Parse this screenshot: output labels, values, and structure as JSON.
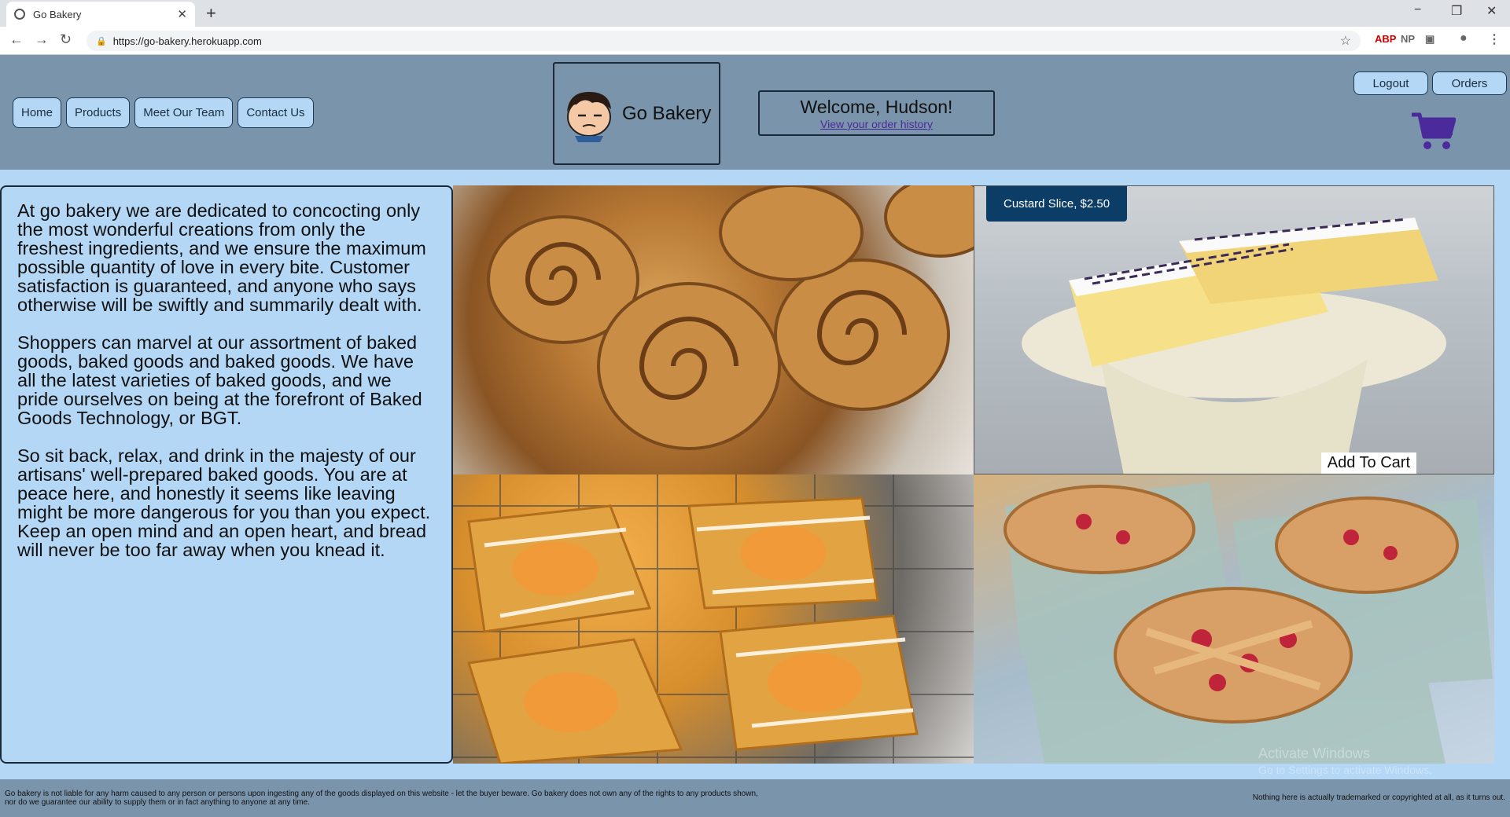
{
  "browser": {
    "tab_title": "Go Bakery",
    "new_tab": "+",
    "url": "https://go-bakery.herokuapp.com",
    "ext_np": "NP",
    "ext_abp": "ABP",
    "win_min": "−",
    "win_restore": "❐",
    "win_close": "✕"
  },
  "nav": {
    "items": [
      {
        "label": "Home"
      },
      {
        "label": "Products"
      },
      {
        "label": "Meet Our Team"
      },
      {
        "label": "Contact Us"
      }
    ]
  },
  "brand": {
    "name": "Go Bakery"
  },
  "welcome": {
    "title": "Welcome, Hudson!",
    "link": "View your order history"
  },
  "account": {
    "logout_label": "Logout",
    "orders_label": "Orders"
  },
  "colors": {
    "header_bg": "#7a94ab",
    "page_bg": "#b3d7f5",
    "cart_icon": "#4b2a9c",
    "caption_bg": "#0b3d66"
  },
  "icons": {
    "cart": "cart-icon",
    "logo": "baker-face-icon"
  },
  "about": {
    "paragraphs": [
      "At go bakery we are dedicated to concocting only the most wonderful creations from only the freshest ingredients, and we ensure the maximum possible quantity of love in every bite. Customer satisfaction is guaranteed, and anyone who says otherwise will be swiftly and summarily dealt with.",
      "Shoppers can marvel at our assortment of baked goods, baked goods and baked goods. We have all the latest varieties of baked goods, and we pride ourselves on being at the forefront of Baked Goods Technology, or BGT.",
      "So sit back, relax, and drink in the majesty of our artisans' well-prepared baked goods. You are at peace here, and honestly it seems like leaving might be more dangerous for you than you expect. Keep an open mind and an open heart, and bread will never be too far away when you knead it."
    ]
  },
  "products": {
    "hovered_caption": "Custard Slice, $2.50",
    "add_to_cart": "Add To Cart"
  },
  "watermark": {
    "line1": "Activate Windows",
    "line2": "Go to Settings to activate Windows."
  },
  "footer": {
    "left": "Go bakery is not liable for any harm caused to any person or persons upon ingesting any of the goods displayed on this website - let the buyer beware. Go bakery does not own any of the rights to any products shown, nor do we guarantee our ability to supply them or in fact anything to anyone at any time.",
    "right": "Nothing here is actually trademarked or copyrighted at all, as it turns out."
  }
}
